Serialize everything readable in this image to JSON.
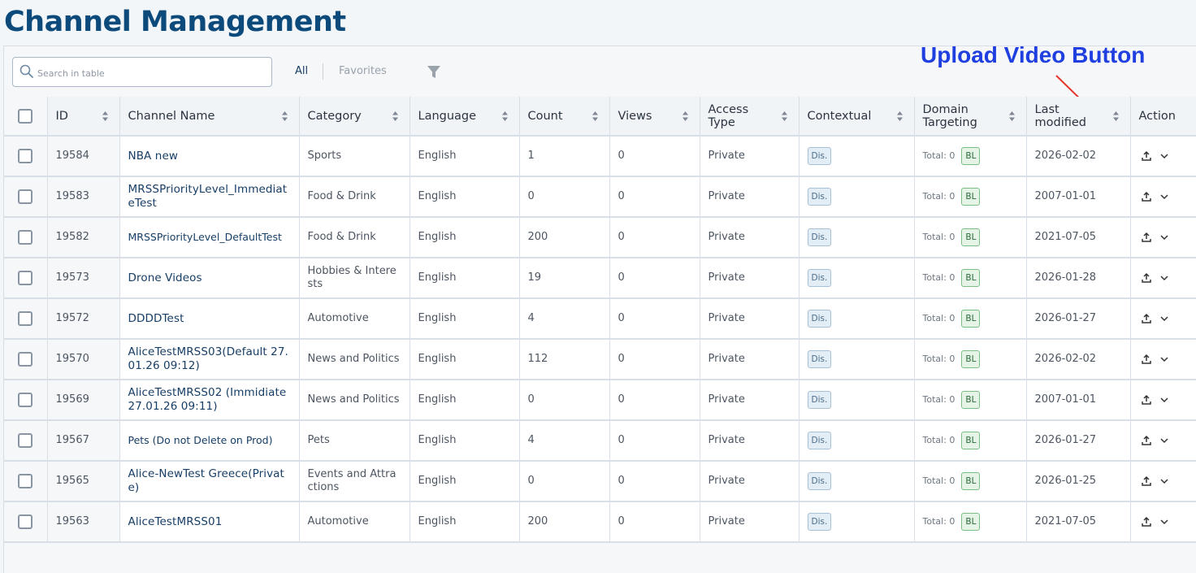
{
  "page": {
    "title": "Channel Management"
  },
  "search": {
    "placeholder": "Search in table"
  },
  "filters": {
    "all_label": "All",
    "favorites_label": "Favorites"
  },
  "annotation": {
    "label": "Upload Video Button",
    "color": "#1f3fe0"
  },
  "columns": [
    "ID",
    "Channel Name",
    "Category",
    "Language",
    "Count",
    "Views",
    "Access Type",
    "Contextual",
    "Domain Targeting",
    "Last modified",
    "Action"
  ],
  "rows": [
    {
      "id": "19584",
      "name": "NBA new",
      "category": "Sports",
      "language": "English",
      "count": "1",
      "views": "0",
      "access": "Private",
      "contextual": "Dis.",
      "total": "Total: 0",
      "bl": "BL",
      "modified": "2026-02-02"
    },
    {
      "id": "19583",
      "name": "MRSSPriorityLevel_ImmediateTest",
      "category": "Food & Drink",
      "language": "English",
      "count": "0",
      "views": "0",
      "access": "Private",
      "contextual": "Dis.",
      "total": "Total: 0",
      "bl": "BL",
      "modified": "2007-01-01"
    },
    {
      "id": "19582",
      "name": "MRSSPriorityLevel_DefaultTest",
      "category": "Food & Drink",
      "language": "English",
      "count": "200",
      "views": "0",
      "access": "Private",
      "contextual": "Dis.",
      "total": "Total: 0",
      "bl": "BL",
      "modified": "2021-07-05"
    },
    {
      "id": "19573",
      "name": "Drone Videos",
      "category": "Hobbies & Interests",
      "language": "English",
      "count": "19",
      "views": "0",
      "access": "Private",
      "contextual": "Dis.",
      "total": "Total: 0",
      "bl": "BL",
      "modified": "2026-01-28"
    },
    {
      "id": "19572",
      "name": "DDDDTest",
      "category": "Automotive",
      "language": "English",
      "count": "4",
      "views": "0",
      "access": "Private",
      "contextual": "Dis.",
      "total": "Total: 0",
      "bl": "BL",
      "modified": "2026-01-27"
    },
    {
      "id": "19570",
      "name": "AliceTestMRSS03(Default 27.01.26 09:12)",
      "category": "News and Politics",
      "language": "English",
      "count": "112",
      "views": "0",
      "access": "Private",
      "contextual": "Dis.",
      "total": "Total: 0",
      "bl": "BL",
      "modified": "2026-02-02"
    },
    {
      "id": "19569",
      "name": "AliceTestMRSS02 (Immidiate 27.01.26 09:11)",
      "category": "News and Politics",
      "language": "English",
      "count": "0",
      "views": "0",
      "access": "Private",
      "contextual": "Dis.",
      "total": "Total: 0",
      "bl": "BL",
      "modified": "2007-01-01"
    },
    {
      "id": "19567",
      "name": "Pets (Do not Delete on Prod)",
      "category": "Pets",
      "language": "English",
      "count": "4",
      "views": "0",
      "access": "Private",
      "contextual": "Dis.",
      "total": "Total: 0",
      "bl": "BL",
      "modified": "2026-01-27"
    },
    {
      "id": "19565",
      "name": "Alice-NewTest Greece(Private)",
      "category": "Events and Attractions",
      "language": "English",
      "count": "0",
      "views": "0",
      "access": "Private",
      "contextual": "Dis.",
      "total": "Total: 0",
      "bl": "BL",
      "modified": "2026-01-25"
    },
    {
      "id": "19563",
      "name": "AliceTestMRSS01",
      "category": "Automotive",
      "language": "English",
      "count": "200",
      "views": "0",
      "access": "Private",
      "contextual": "Dis.",
      "total": "Total: 0",
      "bl": "BL",
      "modified": "2021-07-05"
    }
  ],
  "icons": {
    "search": "search-icon",
    "filter": "funnel-icon",
    "upload": "upload-icon",
    "expand": "chevron-down-icon",
    "sort": "sort-icon"
  }
}
